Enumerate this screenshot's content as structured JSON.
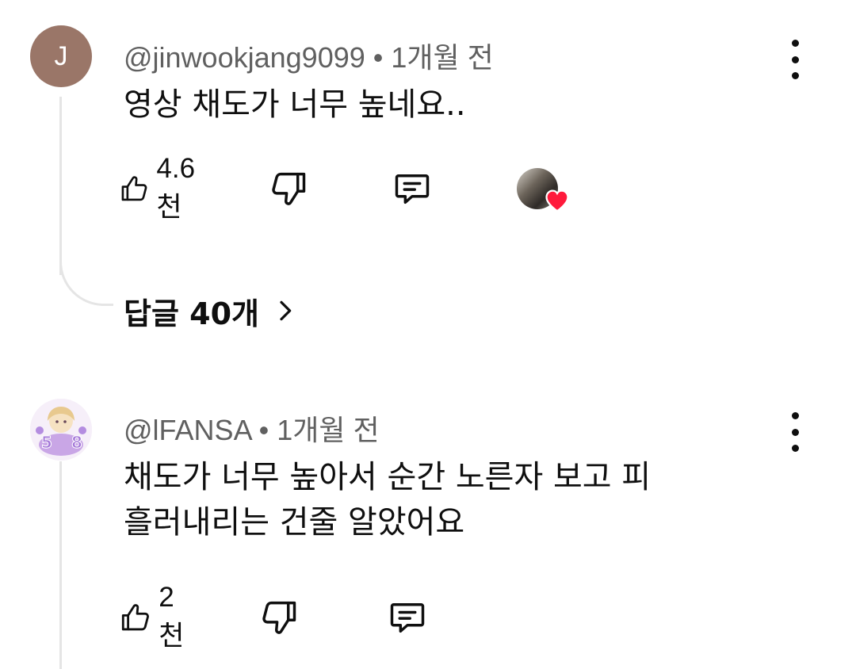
{
  "comments": [
    {
      "avatar_letter": "J",
      "avatar_color": "#9a7668",
      "handle": "@jinwookjang9099",
      "separator": "•",
      "time": "1개월 전",
      "text": "영상 채도가 너무 높네요..",
      "likes": "4.6천",
      "creator_hearted": true,
      "replies_label": "답글 40개"
    },
    {
      "avatar_icon": "anime-avatar-icon",
      "handle": "@lFANSA",
      "separator": "•",
      "time": "1개월 전",
      "text_lines": [
        "채도가 너무 높아서 순간 노른자 보고 피",
        "흘러내리는 건줄 알았어요"
      ],
      "likes": "2천"
    }
  ],
  "colors": {
    "text_primary": "#0f0f0f",
    "text_secondary": "#606060",
    "thread_line": "#e5e5e5",
    "heart": "#ff1a3c"
  },
  "icons": [
    "like-icon",
    "dislike-icon",
    "reply-icon",
    "more-vert-icon",
    "heart-icon",
    "chevron-right-icon"
  ]
}
